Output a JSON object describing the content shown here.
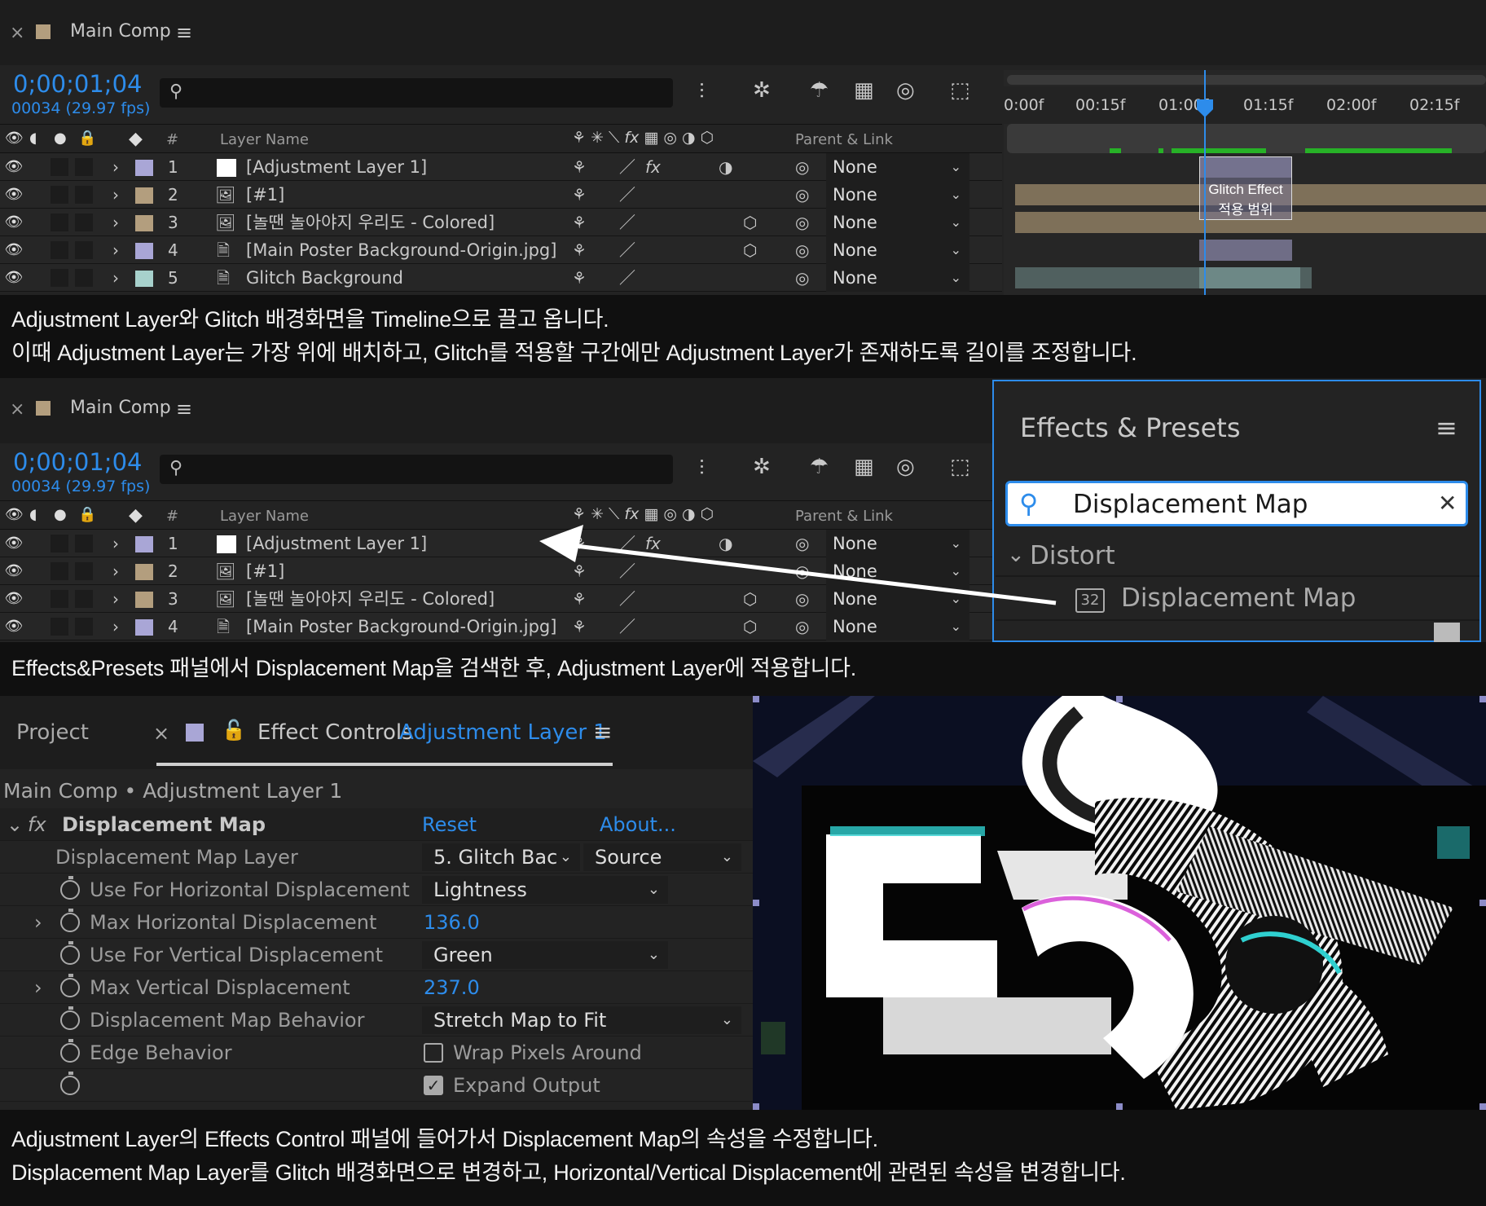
{
  "section1": {
    "comp_tab": {
      "close": "×",
      "title": "Main Comp",
      "menu": "≡"
    },
    "timecode": "0;00;01;04",
    "fps": "00034 (29.97 fps)",
    "columns": {
      "hash": "#",
      "layer_name": "Layer Name",
      "parent_link": "Parent & Link"
    },
    "ruler_labels": [
      "0:00f",
      "00:15f",
      "01:00f",
      "01:15f",
      "02:00f",
      "02:15f"
    ],
    "layers": [
      {
        "num": "1",
        "name": "[Adjustment Layer 1]",
        "parent": "None",
        "color": "#a9a6d6"
      },
      {
        "num": "2",
        "name": "[#1]",
        "parent": "None",
        "color": "#b39e7e"
      },
      {
        "num": "3",
        "name": "[놀땐 놀아야지 우리도 - Colored]",
        "parent": "None",
        "color": "#b39e7e"
      },
      {
        "num": "4",
        "name": "[Main Poster Background-Origin.jpg]",
        "parent": "None",
        "color": "#a9a6d6"
      },
      {
        "num": "5",
        "name": "Glitch Background",
        "parent": "None",
        "color": "#a7d1cc"
      }
    ],
    "annotation_line1": "Glitch Effect",
    "annotation_line2": "적용 범위"
  },
  "caption1_line1": "Adjustment Layer와 Glitch 배경화면을 Timeline으로 끌고 옵니다.",
  "caption1_line2": "이때 Adjustment Layer는 가장 위에 배치하고, Glitch를 적용할 구간에만 Adjustment Layer가 존재하도록 길이를 조정합니다.",
  "section2": {
    "comp_tab": {
      "close": "×",
      "title": "Main Comp",
      "menu": "≡"
    },
    "timecode": "0;00;01;04",
    "fps": "00034 (29.97 fps)",
    "columns": {
      "hash": "#",
      "layer_name": "Layer Name",
      "parent_link": "Parent & Link"
    },
    "layers": [
      {
        "num": "1",
        "name": "[Adjustment Layer 1]",
        "parent": "None",
        "color": "#a9a6d6"
      },
      {
        "num": "2",
        "name": "[#1]",
        "parent": "None",
        "color": "#b39e7e"
      },
      {
        "num": "3",
        "name": "[놀땐 놀아야지 우리도 - Colored]",
        "parent": "None",
        "color": "#b39e7e"
      },
      {
        "num": "4",
        "name": "[Main Poster Background-Origin.jpg]",
        "parent": "None",
        "color": "#a9a6d6"
      }
    ],
    "effects_presets": {
      "title": "Effects & Presets",
      "menu": "≡",
      "search_value": "Displacement Map",
      "clear": "✕",
      "category": "Distort",
      "item": "Displacement Map",
      "item_badge": "32"
    }
  },
  "caption2": "Effects&Presets 패널에서 Displacement Map을 검색한 후, Adjustment Layer에 적용합니다.",
  "section3": {
    "tabs": {
      "project": "Project",
      "close": "×",
      "effect_controls": "Effect Controls",
      "layer": "Adjustment Layer 1",
      "menu": "≡"
    },
    "breadcrumb": "Main Comp • Adjustment Layer 1",
    "effect": {
      "fx": "fx",
      "name": "Displacement Map",
      "reset": "Reset",
      "about": "About..."
    },
    "properties": {
      "map_layer": {
        "label": "Displacement Map Layer",
        "value": "5. Glitch Bac",
        "source": "Source"
      },
      "use_h": {
        "label": "Use For Horizontal Displacement",
        "value": "Lightness"
      },
      "max_h": {
        "label": "Max Horizontal Displacement",
        "value": "136.0"
      },
      "use_v": {
        "label": "Use For Vertical Displacement",
        "value": "Green"
      },
      "max_v": {
        "label": "Max Vertical Displacement",
        "value": "237.0"
      },
      "behavior": {
        "label": "Displacement Map Behavior",
        "value": "Stretch Map to Fit"
      },
      "edge": {
        "label": "Edge Behavior",
        "value": "Wrap Pixels Around"
      },
      "expand": {
        "value": "Expand Output"
      }
    }
  },
  "caption3_line1": "Adjustment Layer의 Effects Control 패널에 들어가서 Displacement Map의 속성을 수정합니다.",
  "caption3_line2": "Displacement Map Layer를 Glitch 배경화면으로 변경하고, Horizontal/Vertical Displacement에 관련된 속성을 변경합니다."
}
